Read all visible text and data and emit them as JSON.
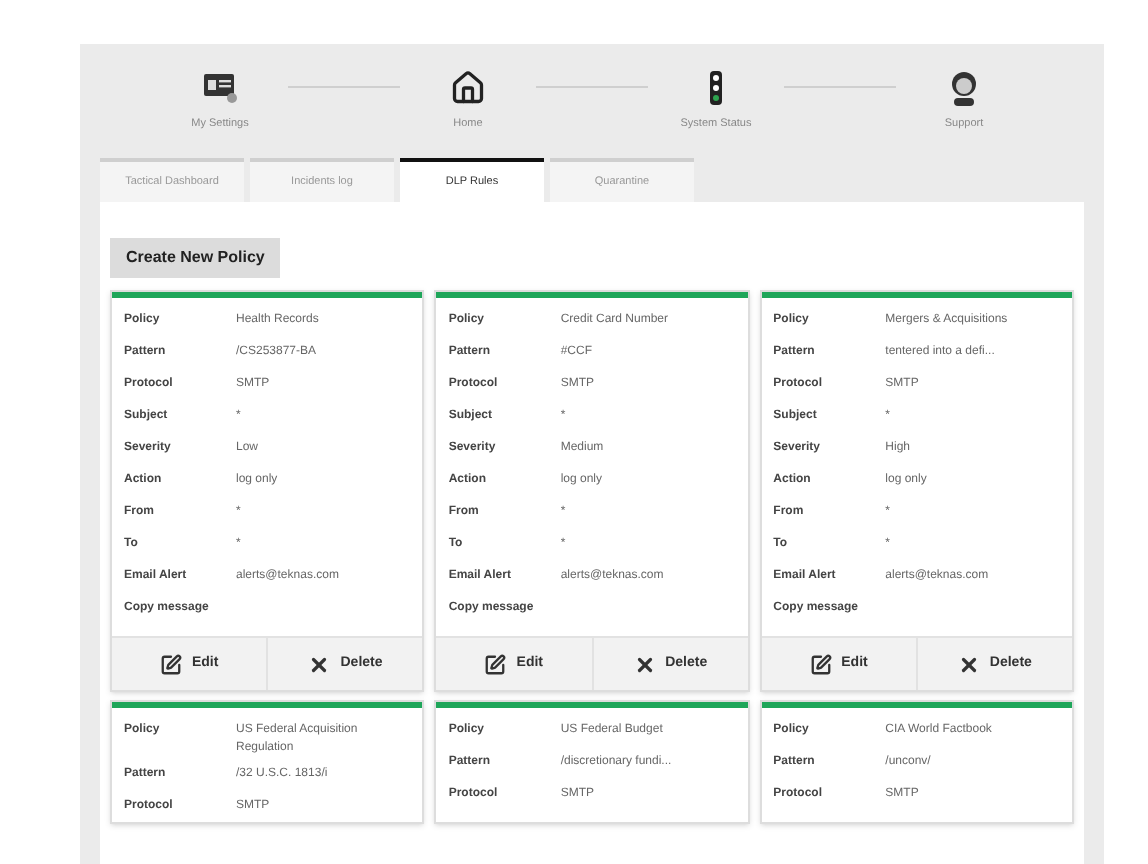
{
  "steps": [
    {
      "kind": "settings",
      "label": "My Settings"
    },
    {
      "kind": "home",
      "label": "Home"
    },
    {
      "kind": "status",
      "label": "System Status"
    },
    {
      "kind": "support",
      "label": "Support"
    }
  ],
  "tabs": [
    {
      "label": "Tactical Dashboard",
      "selected": false
    },
    {
      "label": "Incidents log",
      "selected": false
    },
    {
      "label": "DLP Rules",
      "selected": true
    },
    {
      "label": "Quarantine",
      "selected": false
    }
  ],
  "create_button": "Create New Policy",
  "cards": [
    {
      "fields": [
        {
          "label": "Policy",
          "value": "Health Records"
        },
        {
          "label": "Pattern",
          "value": "/CS253877-BA"
        },
        {
          "label": "Protocol",
          "value": "SMTP"
        },
        {
          "label": "Subject",
          "value": "*"
        },
        {
          "label": "Severity",
          "value": "Low"
        },
        {
          "label": "Action",
          "value": "log only"
        },
        {
          "label": "From",
          "value": "*"
        },
        {
          "label": "To",
          "value": "*"
        },
        {
          "label": "Email Alert",
          "value": "alerts@teknas.com"
        },
        {
          "label": "Copy message"
        }
      ],
      "actions": [
        "Edit",
        "Delete"
      ]
    },
    {
      "fields": [
        {
          "label": "Policy",
          "value": "Credit Card Number"
        },
        {
          "label": "Pattern",
          "value": "#CCF"
        },
        {
          "label": "Protocol",
          "value": "SMTP"
        },
        {
          "label": "Subject",
          "value": "*"
        },
        {
          "label": "Severity",
          "value": "Medium"
        },
        {
          "label": "Action",
          "value": "log only"
        },
        {
          "label": "From",
          "value": "*"
        },
        {
          "label": "To",
          "value": "*"
        },
        {
          "label": "Email Alert",
          "value": "alerts@teknas.com"
        },
        {
          "label": "Copy message"
        }
      ],
      "actions": [
        "Edit",
        "Delete"
      ]
    },
    {
      "fields": [
        {
          "label": "Policy",
          "value": "Mergers & Acquisitions"
        },
        {
          "label": "Pattern",
          "value": "tentered into a defi..."
        },
        {
          "label": "Protocol",
          "value": "SMTP"
        },
        {
          "label": "Subject",
          "value": "*"
        },
        {
          "label": "Severity",
          "value": "High"
        },
        {
          "label": "Action",
          "value": "log only"
        },
        {
          "label": "From",
          "value": "*"
        },
        {
          "label": "To",
          "value": "*"
        },
        {
          "label": "Email Alert",
          "value": "alerts@teknas.com"
        },
        {
          "label": "Copy message"
        }
      ],
      "actions": [
        "Edit",
        "Delete"
      ]
    },
    {
      "fields": [
        {
          "label": "Policy",
          "value": "US Federal Acquisition Regulation"
        },
        {
          "label": "Pattern",
          "value": "/32 U.S.C. 1813/i"
        },
        {
          "label": "Protocol",
          "value": "SMTP"
        }
      ]
    },
    {
      "fields": [
        {
          "label": "Policy",
          "value": "US Federal Budget"
        },
        {
          "label": "Pattern",
          "value": "/discretionary fundi..."
        },
        {
          "label": "Protocol",
          "value": "SMTP"
        }
      ]
    },
    {
      "fields": [
        {
          "label": "Policy",
          "value": "CIA World Factbook"
        },
        {
          "label": "Pattern",
          "value": "/unconv/"
        },
        {
          "label": "Protocol",
          "value": "SMTP"
        }
      ]
    }
  ]
}
